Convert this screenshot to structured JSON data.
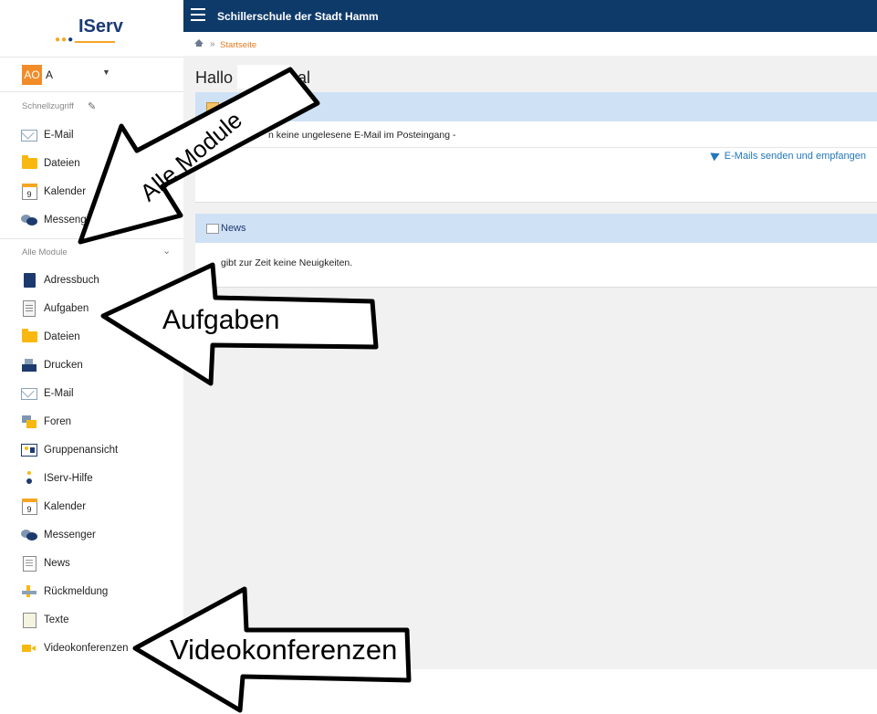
{
  "logo": {
    "text": "IServ"
  },
  "user": {
    "initials": "AO",
    "name": "A"
  },
  "sidebar": {
    "quick_label": "Schnellzugriff",
    "quick_items": [
      {
        "label": "E-Mail",
        "icon": "mail-icon"
      },
      {
        "label": "Dateien",
        "icon": "folder-icon"
      },
      {
        "label": "Kalender",
        "icon": "calendar-icon"
      },
      {
        "label": "Messenger",
        "icon": "messenger-icon"
      }
    ],
    "all_label": "Alle Module",
    "all_items": [
      {
        "label": "Adressbuch",
        "icon": "address-book-icon"
      },
      {
        "label": "Aufgaben",
        "icon": "tasks-icon"
      },
      {
        "label": "Dateien",
        "icon": "folder-icon"
      },
      {
        "label": "Drucken",
        "icon": "printer-icon"
      },
      {
        "label": "E-Mail",
        "icon": "mail-icon"
      },
      {
        "label": "Foren",
        "icon": "forum-icon"
      },
      {
        "label": "Gruppenansicht",
        "icon": "group-icon"
      },
      {
        "label": "IServ-Hilfe",
        "icon": "help-icon"
      },
      {
        "label": "Kalender",
        "icon": "calendar-icon"
      },
      {
        "label": "Messenger",
        "icon": "messenger-icon"
      },
      {
        "label": "News",
        "icon": "news-icon"
      },
      {
        "label": "Rückmeldung",
        "icon": "feedback-icon"
      },
      {
        "label": "Texte",
        "icon": "texts-icon"
      },
      {
        "label": "Videokonferenzen",
        "icon": "video-icon"
      }
    ],
    "calendar_day": "9"
  },
  "header": {
    "school": "Schillerschule der Stadt Hamm"
  },
  "breadcrumb": {
    "sep": "»",
    "link": "Startseite"
  },
  "main": {
    "greeting_prefix": "Hallo /",
    "greeting_suffix": "al",
    "email_panel": {
      "title": "E",
      "message": "n keine ungelesene E-Mail im Posteingang -",
      "link": "E-Mails senden und empfangen"
    },
    "news_panel": {
      "title": "News",
      "message": "gibt zur Zeit keine Neuigkeiten."
    }
  },
  "annotations": {
    "alle_module": "Alle Module",
    "aufgaben": "Aufgaben",
    "videokonferenzen": "Videokonferenzen"
  },
  "colors": {
    "topbar": "#0e3a6a",
    "accent_orange": "#e07a1f",
    "panel_head": "#cfe1f5",
    "link_blue": "#2277bb",
    "avatar": "#f28c28"
  }
}
